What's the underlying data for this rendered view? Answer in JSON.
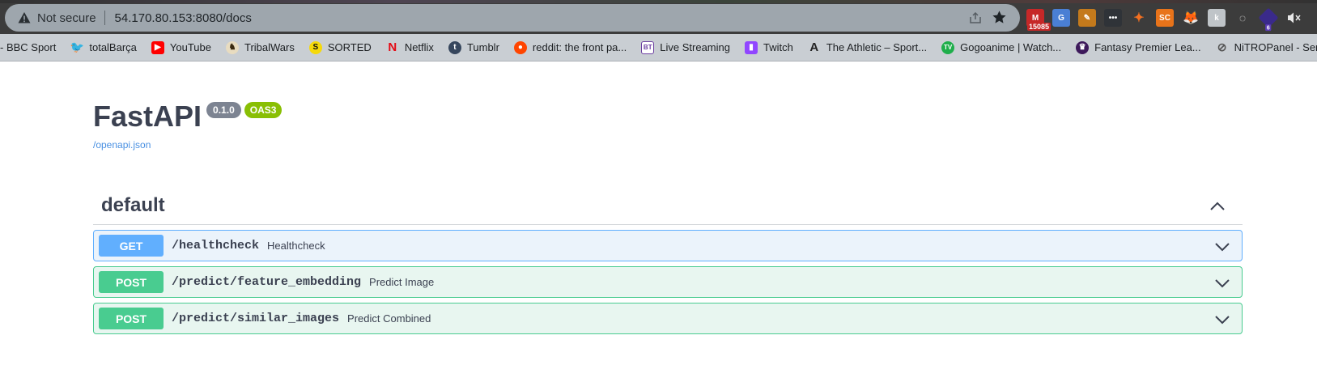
{
  "browser": {
    "security_label": "Not secure",
    "url": "54.170.80.153:8080/docs",
    "extensions": [
      {
        "name": "gmail-icon",
        "badge": "15085"
      },
      {
        "name": "translate-icon"
      },
      {
        "name": "notes-icon"
      },
      {
        "name": "dots-ext-icon"
      },
      {
        "name": "flame-ext-icon"
      },
      {
        "name": "sc-ext-icon",
        "text": "SC"
      },
      {
        "name": "metamask-icon"
      },
      {
        "name": "k-ext-icon"
      },
      {
        "name": "ghost-ext-icon"
      },
      {
        "name": "cube-ext-icon",
        "badge": "6"
      },
      {
        "name": "mute-icon"
      }
    ]
  },
  "bookmarks": [
    {
      "label": "- BBC Sport",
      "icon": "none",
      "color": ""
    },
    {
      "label": "totalBarça",
      "icon": "twitter-icon",
      "color": "#1da1f2"
    },
    {
      "label": "YouTube",
      "icon": "youtube-icon",
      "color": "#ff0000"
    },
    {
      "label": "TribalWars",
      "icon": "tribalwars-icon",
      "color": "#7a5a2a"
    },
    {
      "label": "SORTED",
      "icon": "sorted-icon",
      "color": "#f5d90a"
    },
    {
      "label": "Netflix",
      "icon": "netflix-icon",
      "color": "#e50914"
    },
    {
      "label": "Tumblr",
      "icon": "tumblr-icon",
      "color": "#36465d"
    },
    {
      "label": "reddit: the front pa...",
      "icon": "reddit-icon",
      "color": "#ff4500"
    },
    {
      "label": "Live Streaming",
      "icon": "bt-icon",
      "color": "#6b3fa0"
    },
    {
      "label": "Twitch",
      "icon": "twitch-icon",
      "color": "#9146ff"
    },
    {
      "label": "The Athletic – Sport...",
      "icon": "athletic-icon",
      "color": "#222222"
    },
    {
      "label": "Gogoanime | Watch...",
      "icon": "gogoanime-icon",
      "color": "#1fae4b"
    },
    {
      "label": "Fantasy Premier Lea...",
      "icon": "premier-league-icon",
      "color": "#3d195b"
    },
    {
      "label": "NiTROPanel - Serve...",
      "icon": "nitropanel-icon",
      "color": "#666666"
    }
  ],
  "api": {
    "title": "FastAPI",
    "version": "0.1.0",
    "oas": "OAS3",
    "spec_link": "/openapi.json"
  },
  "section": {
    "title": "default",
    "operations": [
      {
        "method": "GET",
        "path": "/healthcheck",
        "summary": "Healthcheck"
      },
      {
        "method": "POST",
        "path": "/predict/feature_embedding",
        "summary": "Predict Image"
      },
      {
        "method": "POST",
        "path": "/predict/similar_images",
        "summary": "Predict Combined"
      }
    ]
  },
  "colors": {
    "get": "#61affe",
    "post": "#49cc90",
    "oas_badge": "#89bf04",
    "version_badge": "#7d8492"
  }
}
